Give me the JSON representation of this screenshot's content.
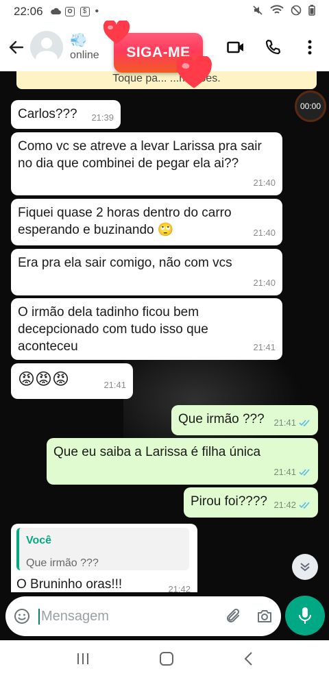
{
  "status_bar": {
    "time": "22:06",
    "dot": "•"
  },
  "header": {
    "emoji_name": "💨",
    "status": "online",
    "sticker_text": "SIGA-ME"
  },
  "chat": {
    "banner_text": "Toque pa...  ...mações.",
    "timer_text": "00:00",
    "messages": [
      {
        "text": "Carlos???",
        "time": "21:39"
      },
      {
        "text": "Como vc se atreve a levar Larissa pra sair no dia que combinei de pegar ela ai??",
        "time": "21:40"
      },
      {
        "text": "Fiquei quase 2 horas dentro do carro esperando e buzinando 🙄",
        "time": "21:40"
      },
      {
        "text": "Era pra ela sair comigo, não com vcs",
        "time": "21:40"
      },
      {
        "text": "O irmão dela tadinho ficou bem decepcionado com tudo isso que aconteceu",
        "time": "21:41"
      },
      {
        "text": "😡😡😡",
        "time": "21:41"
      },
      {
        "text": "Que irmão ???",
        "time": "21:41"
      },
      {
        "text": "Que eu saiba a Larissa é filha única",
        "time": "21:41"
      },
      {
        "text": "Pirou foi????",
        "time": "21:42"
      },
      {
        "quote_author": "Você",
        "quote_text": "Que irmão ???",
        "text": "O Bruninho oras!!!",
        "time": "21:42"
      }
    ]
  },
  "composer": {
    "placeholder": "Mensagem"
  },
  "colors": {
    "accent": "#00a884",
    "outgoing": "#e0fbcf",
    "incoming": "#ffffff",
    "read_ticks": "#53bdeb"
  }
}
